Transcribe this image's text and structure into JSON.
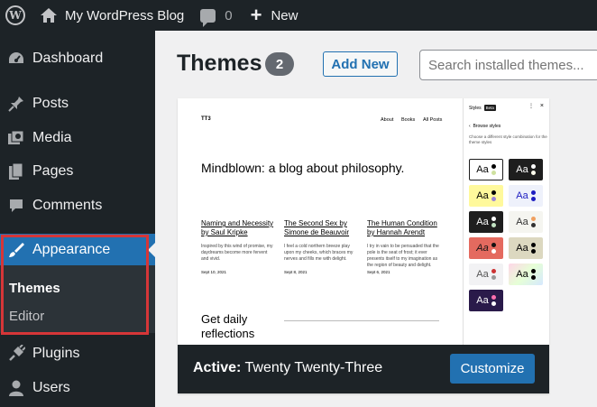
{
  "adminbar": {
    "site_name": "My WordPress Blog",
    "comments_count": "0",
    "new_label": "New"
  },
  "sidebar": {
    "items": [
      {
        "label": "Dashboard",
        "icon": "dashboard-icon"
      },
      {
        "label": "Posts",
        "icon": "pin-icon"
      },
      {
        "label": "Media",
        "icon": "media-icon"
      },
      {
        "label": "Pages",
        "icon": "pages-icon"
      },
      {
        "label": "Comments",
        "icon": "comment-icon"
      },
      {
        "label": "Appearance",
        "icon": "brush-icon"
      },
      {
        "label": "Plugins",
        "icon": "plugin-icon"
      },
      {
        "label": "Users",
        "icon": "user-icon"
      }
    ],
    "submenu": [
      {
        "label": "Themes"
      },
      {
        "label": "Editor"
      }
    ]
  },
  "page": {
    "title": "Themes",
    "count": "2",
    "add_new_label": "Add New",
    "search_placeholder": "Search installed themes..."
  },
  "theme_preview": {
    "site_title": "TT3",
    "nav": [
      "About",
      "Books",
      "All Posts"
    ],
    "headline": "Mindblown: a blog about philosophy.",
    "posts": [
      {
        "title": "Naming and Necessity by Saul Kripke",
        "excerpt": "Inspired by this wind of promise, my daydreams become more fervent and vivid.",
        "date": "Sept 10, 2021"
      },
      {
        "title": "The Second Sex by Simone de Beauvoir",
        "excerpt": "I feel a cold northern breeze play upon my cheeks, which braces my nerves and fills me with delight.",
        "date": "Sept 8, 2021"
      },
      {
        "title": "The Human Condition by Hannah Arendt",
        "excerpt": "I try in vain to be persuaded that the pole is the seat of frost; it ever presents itself to my imagination as the region of beauty and delight.",
        "date": "Sept 6, 2021"
      }
    ],
    "cta": "Get daily reflections",
    "styles_panel": {
      "title": "Styles",
      "badge": "Beta",
      "browse": "Browse styles",
      "description": "Choose a different style combination for the theme styles",
      "sample": "Aa"
    }
  },
  "active_theme": {
    "prefix": "Active:",
    "name": "Twenty Twenty-Three",
    "customize_label": "Customize"
  },
  "colors": {
    "admin_bar": "#1d2327",
    "accent": "#2271b1",
    "highlight_border": "#d63638"
  }
}
